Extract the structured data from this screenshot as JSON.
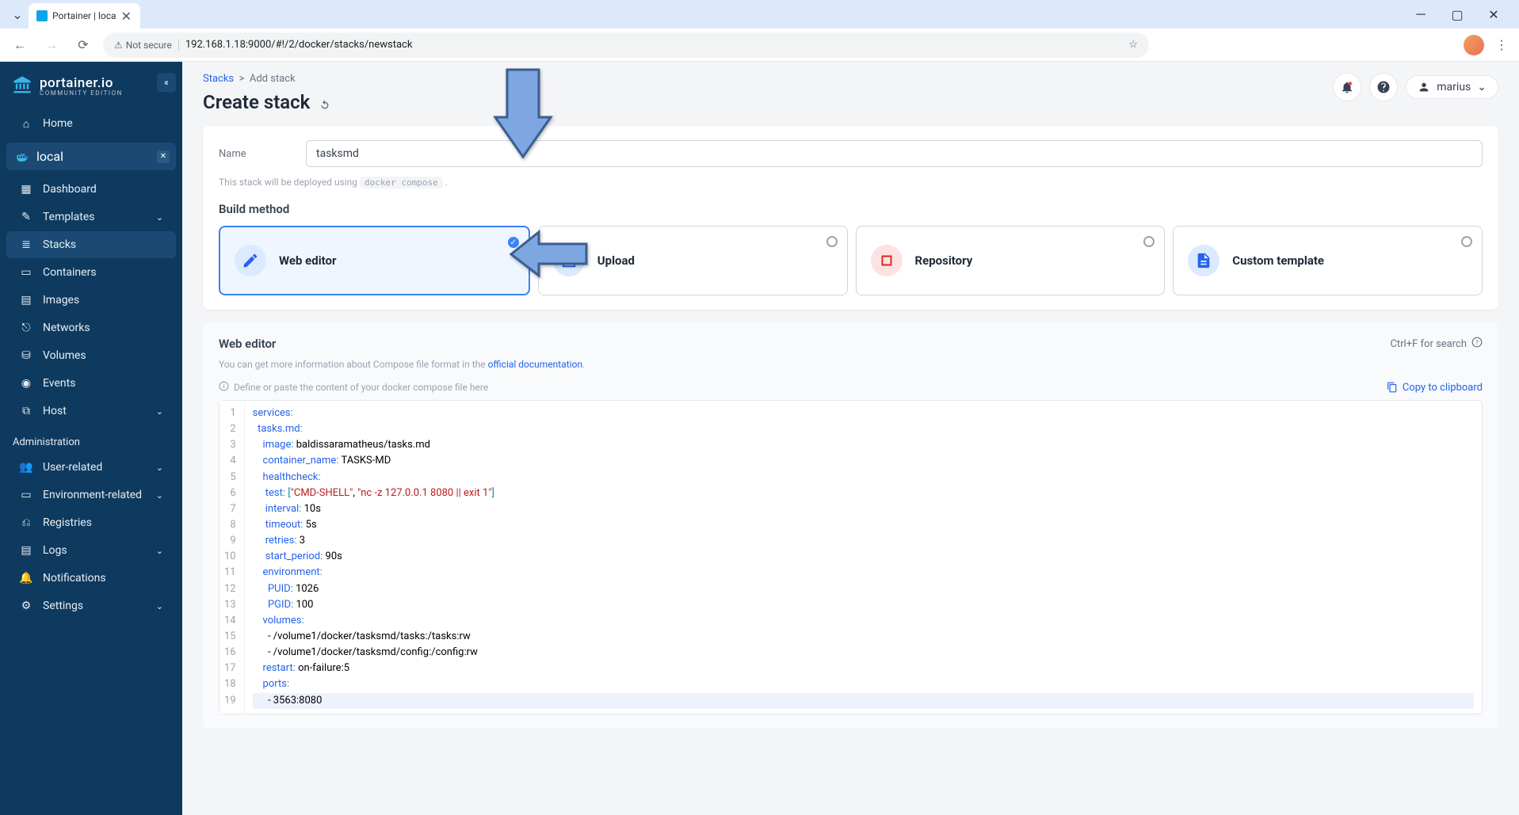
{
  "browser": {
    "tab_title": "Portainer | loca",
    "url": "192.168.1.18:9000/#!/2/docker/stacks/newstack",
    "not_secure": "Not secure"
  },
  "sidebar": {
    "brand": "portainer.io",
    "edition": "COMMUNITY EDITION",
    "home": "Home",
    "env_name": "local",
    "items": [
      {
        "label": "Dashboard",
        "icon": "dashboard"
      },
      {
        "label": "Templates",
        "icon": "templates",
        "expandable": true
      },
      {
        "label": "Stacks",
        "icon": "stacks",
        "active": true
      },
      {
        "label": "Containers",
        "icon": "containers"
      },
      {
        "label": "Images",
        "icon": "images"
      },
      {
        "label": "Networks",
        "icon": "networks"
      },
      {
        "label": "Volumes",
        "icon": "volumes"
      },
      {
        "label": "Events",
        "icon": "events"
      },
      {
        "label": "Host",
        "icon": "host",
        "expandable": true
      }
    ],
    "admin_header": "Administration",
    "admin_items": [
      {
        "label": "User-related",
        "expandable": true
      },
      {
        "label": "Environment-related",
        "expandable": true
      },
      {
        "label": "Registries"
      },
      {
        "label": "Logs",
        "expandable": true
      },
      {
        "label": "Notifications"
      },
      {
        "label": "Settings",
        "expandable": true
      }
    ]
  },
  "header": {
    "breadcrumb_root": "Stacks",
    "breadcrumb_sep": ">",
    "breadcrumb_leaf": "Add stack",
    "title": "Create stack",
    "user": "marius"
  },
  "form": {
    "name_label": "Name",
    "name_value": "tasksmd",
    "deploy_hint_pre": "This stack will be deployed using",
    "deploy_hint_code": "docker compose",
    "deploy_hint_post": "."
  },
  "build": {
    "section": "Build method",
    "methods": [
      {
        "label": "Web editor",
        "selected": true
      },
      {
        "label": "Upload"
      },
      {
        "label": "Repository"
      },
      {
        "label": "Custom template"
      }
    ]
  },
  "editor": {
    "title": "Web editor",
    "search_hint": "Ctrl+F for search",
    "sub_pre": "You can get more information about Compose file format in the ",
    "sub_link": "official documentation",
    "sub_post": ".",
    "define_hint": "Define or paste the content of your docker compose file here",
    "copy": "Copy to clipboard",
    "code_lines": [
      "services:",
      "  tasks.md:",
      "    image: baldissaramatheus/tasks.md",
      "    container_name: TASKS-MD",
      "    healthcheck:",
      "     test: [\"CMD-SHELL\", \"nc -z 127.0.0.1 8080 || exit 1\"]",
      "     interval: 10s",
      "     timeout: 5s",
      "     retries: 3",
      "     start_period: 90s",
      "    environment:",
      "      PUID: 1026",
      "      PGID: 100",
      "    volumes:",
      "      - /volume1/docker/tasksmd/tasks:/tasks:rw",
      "      - /volume1/docker/tasksmd/config:/config:rw",
      "    restart: on-failure:5",
      "    ports:",
      "      - 3563:8080"
    ]
  }
}
